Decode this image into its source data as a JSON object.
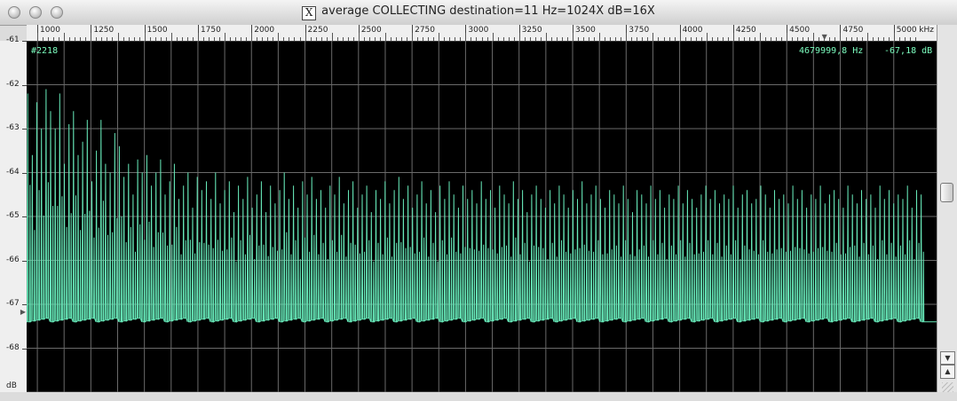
{
  "window": {
    "title": "average  COLLECTING destination=11 Hz=1024X dB=16X",
    "title_icon": "x-window-icon"
  },
  "ruler": {
    "ticks": [
      "1000",
      "1250",
      "1500",
      "1750",
      "2000",
      "2250",
      "2500",
      "2750",
      "3000",
      "3250",
      "3500",
      "3750",
      "4000",
      "4250",
      "4500",
      "4750",
      "5000"
    ],
    "unit": "kHz"
  },
  "yaxis": {
    "ticks": [
      "-61",
      "-62",
      "-63",
      "-64",
      "-65",
      "-66",
      "-67",
      "-68"
    ],
    "unit": "dB"
  },
  "overlay": {
    "frame": "#2218",
    "freq_readout": "4679999,8 Hz",
    "db_readout": "-67,18 dB"
  },
  "colors": {
    "trace": "#66e8b8",
    "grid": "#6a6a6a",
    "background": "#000000",
    "readout": "#7dffc0"
  },
  "chart_data": {
    "type": "line",
    "title": "",
    "xlabel": "kHz",
    "ylabel": "dB",
    "xlim": [
      950,
      5200
    ],
    "ylim": [
      -69,
      -61
    ],
    "noise_floor": -67.4,
    "peak_step_khz": 21.4,
    "peak_tops": [
      -62.2,
      -63.6,
      -62.4,
      -63.0,
      -62.1,
      -62.6,
      -63.0,
      -62.2,
      -63.8,
      -62.9,
      -62.6,
      -63.6,
      -63.3,
      -62.8,
      -64.2,
      -63.5,
      -62.8,
      -63.8,
      -64.0,
      -63.1,
      -63.4,
      -64.1,
      -63.8,
      -64.5,
      -63.7,
      -64.0,
      -63.6,
      -64.3,
      -64.0,
      -63.7,
      -64.5,
      -64.2,
      -63.8,
      -64.6,
      -64.3,
      -64.0,
      -64.8,
      -64.1,
      -64.4,
      -64.2,
      -64.6,
      -64.0,
      -64.7,
      -64.4,
      -64.2,
      -64.9,
      -64.3,
      -64.6,
      -64.1,
      -64.8,
      -64.5,
      -64.2,
      -64.9,
      -64.3,
      -64.7,
      -64.4,
      -64.0,
      -64.6,
      -64.3,
      -64.8,
      -64.2,
      -64.5,
      -64.1,
      -64.6,
      -64.4,
      -64.8,
      -64.3,
      -64.5,
      -64.1,
      -64.7,
      -64.4,
      -64.2,
      -64.8,
      -64.5,
      -64.3,
      -64.9,
      -64.4,
      -64.6,
      -64.2,
      -64.7,
      -64.4,
      -64.1,
      -64.6,
      -64.3,
      -64.8,
      -64.5,
      -64.2,
      -64.7,
      -64.4,
      -64.9,
      -64.3,
      -64.6,
      -64.2,
      -64.5,
      -64.8,
      -64.3,
      -64.6,
      -64.4,
      -64.7,
      -64.2,
      -64.6,
      -64.4,
      -64.8,
      -64.3,
      -64.5,
      -64.7,
      -64.2,
      -64.6,
      -64.4,
      -64.9,
      -64.5,
      -64.3,
      -64.6,
      -64.8,
      -64.4,
      -64.7,
      -64.3,
      -64.5,
      -64.8,
      -64.4,
      -64.6,
      -64.2,
      -64.7,
      -64.5,
      -64.3,
      -64.6,
      -64.8,
      -64.4,
      -64.5,
      -64.7,
      -64.3,
      -64.6,
      -64.9,
      -64.4,
      -64.5,
      -64.7,
      -64.3,
      -64.6,
      -64.4,
      -64.8,
      -64.5,
      -64.6,
      -64.3,
      -64.7,
      -64.4,
      -64.6,
      -64.8,
      -64.5,
      -64.3,
      -64.6,
      -64.4,
      -64.7,
      -64.5,
      -64.6,
      -64.3,
      -64.8,
      -64.5,
      -64.4,
      -64.7,
      -64.6,
      -64.3,
      -64.5,
      -64.8,
      -64.4,
      -64.6,
      -64.5,
      -64.7,
      -64.3,
      -64.6,
      -64.4,
      -64.8,
      -64.5,
      -64.6,
      -64.3,
      -64.7,
      -64.5,
      -64.4,
      -64.6,
      -64.8,
      -64.3,
      -64.5,
      -64.7,
      -64.4,
      -64.6,
      -64.5,
      -64.8,
      -64.3,
      -64.6,
      -64.4,
      -64.7,
      -64.5,
      -64.6,
      -64.3,
      -64.8,
      -64.4,
      -64.5
    ]
  }
}
